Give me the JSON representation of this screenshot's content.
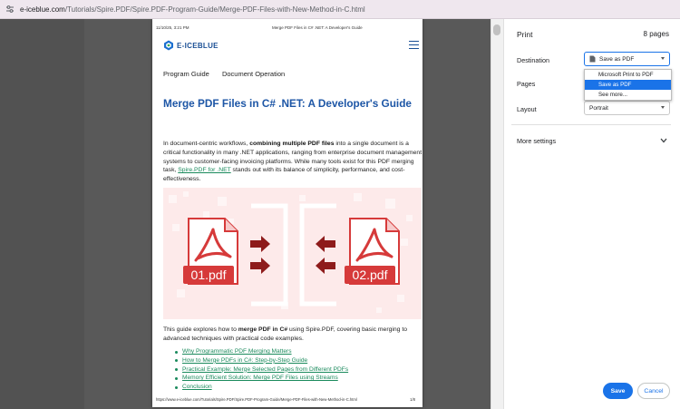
{
  "browser": {
    "url_host": "e-iceblue.com",
    "url_path": "/Tutorials/Spire.PDF/Spire.PDF-Program-Guide/Merge-PDF-Files-with-New-Method-in-C.html"
  },
  "page": {
    "header_date": "11/10/25, 3:21 PM",
    "header_title": "Merge PDF Files in C# .NET: A Developer's Guide",
    "logo_text": "E-ICEBLUE",
    "nav": [
      "Program Guide",
      "Document Operation"
    ],
    "heading": "Merge PDF Files in C# .NET: A Developer's Guide",
    "intro_1": "In document-centric workflows, ",
    "intro_bold": "combining multiple PDF files",
    "intro_2": " into a single document is a critical functionality in many .NET applications, ranging from enterprise document management systems to customer-facing invoicing platforms. While many tools exist for this PDF merging task, ",
    "intro_link": "Spire.PDF for .NET",
    "intro_3": " stands out with its balance of simplicity, performance, and cost-effectiveness.",
    "banner_file_left": "01.pdf",
    "banner_file_right": "02.pdf",
    "guide_1": "This guide explores how to ",
    "guide_bold": "merge PDF in C#",
    "guide_2": " using Spire.PDF, covering basic merging to advanced techniques with practical code examples.",
    "toc": [
      "Why Programmatic PDF Merging Matters",
      "How to Merge PDFs in C#: Step-by-Step Guide",
      "Practical Example: Merge Selected Pages from Different PDFs",
      "Memory Efficient Solution: Merge PDF Files using Streams",
      "Conclusion"
    ],
    "footer_url": "https://www.e-iceblue.com/Tutorials/Spire.PDF/Spire.PDF-Program-Guide/Merge-PDF-Files-with-New-Method-in-C.html",
    "footer_page": "1/8"
  },
  "print": {
    "title": "Print",
    "page_count": "8 pages",
    "destination_label": "Destination",
    "destination_value": "Save as PDF",
    "destination_options": [
      "Microsoft Print to PDF",
      "Save as PDF",
      "See more..."
    ],
    "pages_label": "Pages",
    "layout_label": "Layout",
    "layout_value": "Portrait",
    "more_settings": "More settings",
    "save_label": "Save",
    "cancel_label": "Cancel"
  },
  "colors": {
    "accent": "#1a73e8",
    "heading_blue": "#1d56a6",
    "link_green": "#1a8a5c",
    "pdf_red": "#d63a3a",
    "arrow_red": "#8e1b1b",
    "banner_bg": "#fdeaea"
  }
}
